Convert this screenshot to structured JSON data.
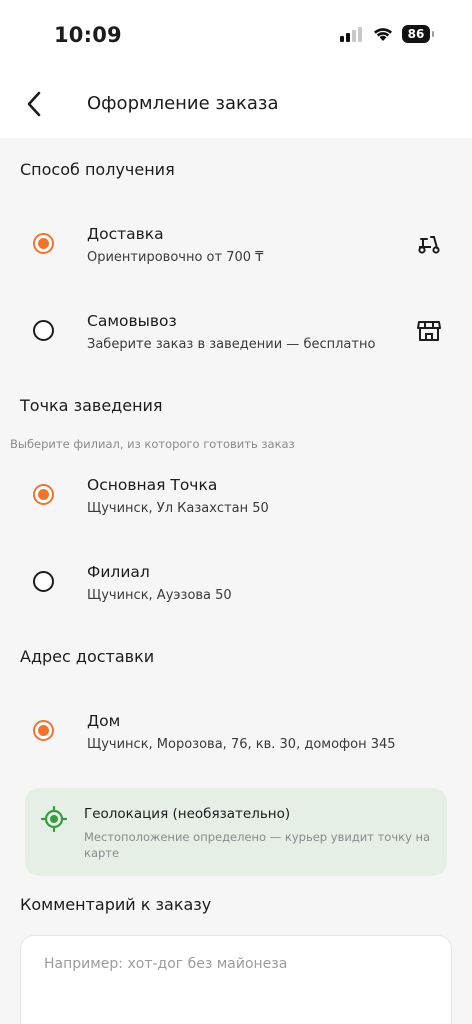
{
  "status": {
    "time": "10:09",
    "battery": "86"
  },
  "header": {
    "title": "Оформление заказа"
  },
  "receipt": {
    "title": "Способ получения",
    "options": [
      {
        "title": "Доставка",
        "subtitle": "Ориентировочно от 700 ₸",
        "selected": true,
        "icon": "scooter-icon"
      },
      {
        "title": "Самовывоз",
        "subtitle": "Заберите заказ в заведении — бесплатно",
        "selected": false,
        "icon": "store-icon"
      }
    ]
  },
  "branch": {
    "title": "Точка заведения",
    "hint": "Выберите филиал, из которого готовить заказ",
    "options": [
      {
        "title": "Основная Точка",
        "subtitle": "Щучинск, Ул Казахстан 50",
        "selected": true
      },
      {
        "title": "Филиал",
        "subtitle": "Щучинск, Ауэзова 50",
        "selected": false
      }
    ]
  },
  "address": {
    "title": "Адрес доставки",
    "options": [
      {
        "title": "Дом",
        "subtitle": "Щучинск, Морозова, 76, кв. 30, домофон 345",
        "selected": true
      }
    ]
  },
  "geo": {
    "title": "Геолокация (необязательно)",
    "text": "Местоположение определено — курьер увидит точку на карте"
  },
  "comment": {
    "title": "Комментарий к заказу",
    "placeholder": "Например: хот-дог без майонеза"
  },
  "colors": {
    "accent": "#f07330",
    "geo_green": "#3a9a3f",
    "geo_bg": "#e5efe5"
  }
}
